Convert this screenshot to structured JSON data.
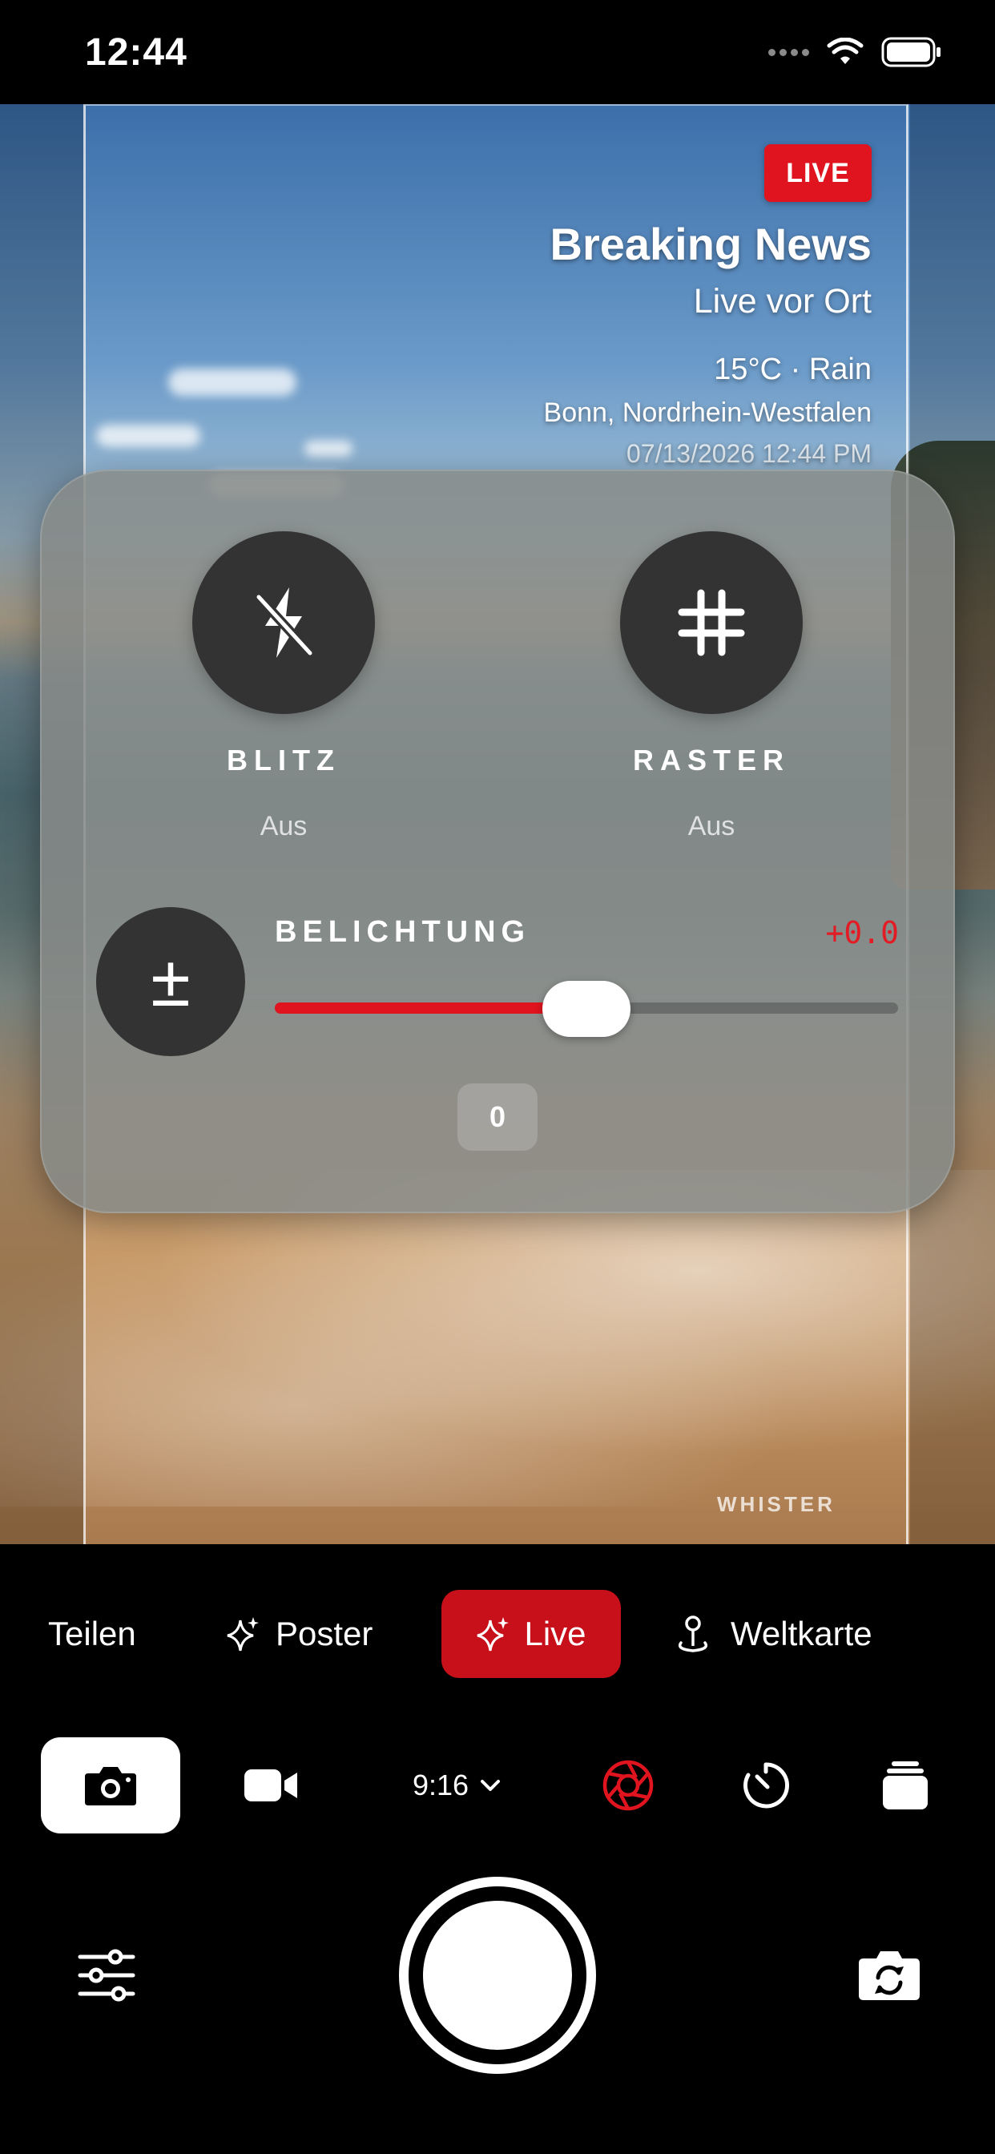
{
  "status": {
    "time": "12:44"
  },
  "overlay": {
    "live_badge": "LIVE",
    "headline": "Breaking News",
    "subheadline": "Live vor Ort",
    "weather": "15°C · Rain",
    "location": "Bonn, Nordrhein-Westfalen",
    "timestamp": "07/13/2026 12:44 PM",
    "watermark": "WHISTER"
  },
  "panel": {
    "flash": {
      "label": "BLITZ",
      "state": "Aus",
      "icon": "flash-off-icon"
    },
    "grid": {
      "label": "RASTER",
      "state": "Aus",
      "icon": "grid-icon"
    },
    "exposure": {
      "label": "BELICHTUNG",
      "value_text": "+0.0",
      "slider_fraction": 0.5,
      "reset_label": "0",
      "icon": "plus-minus-icon"
    }
  },
  "modes": [
    {
      "label": "Teilen",
      "active": false
    },
    {
      "label": "Poster",
      "active": false,
      "icon": "sparkle-icon"
    },
    {
      "label": "Live",
      "active": true,
      "icon": "sparkle-icon"
    },
    {
      "label": "Weltkarte",
      "active": false,
      "icon": "map-pin-icon"
    }
  ],
  "toolbar": {
    "aspect_ratio": "9:16",
    "items": [
      "camera-icon",
      "video-icon",
      "aspect-ratio",
      "aperture-icon",
      "timer-icon",
      "layers-icon"
    ]
  },
  "colors": {
    "accent_red": "#e0141e",
    "mode_active": "#c8101a",
    "panel_bg": "#878a88"
  }
}
